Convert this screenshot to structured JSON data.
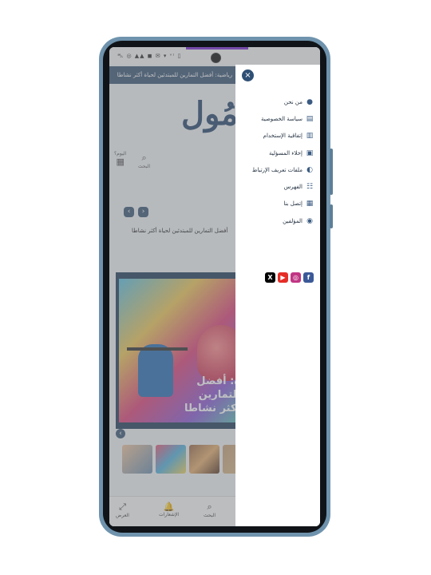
{
  "status_bar": {
    "icons": "⛍ ◎ ▲▲ ◼ ✉ ▾ ᵛᶦ ▯"
  },
  "ticker": {
    "text": "رياضية: أفضل التمارين للمبتدئين لحياة أكثر نشاطا"
  },
  "site": {
    "logo": "مُول"
  },
  "top_nav": {
    "search_label": "البحث",
    "today_label": "اليوم؟"
  },
  "headline": {
    "text": "أفضل التمارين للمبتدئين لحياة أكثر نشاطا"
  },
  "hero": {
    "title_line1": "ة: أفضل التمارين",
    "title_line2": "أكثر نشاطا"
  },
  "bottom_nav": [
    {
      "label": "البحث",
      "icon": "search-icon"
    },
    {
      "label": "الإشعارات",
      "icon": "bell-icon"
    },
    {
      "label": "العرض",
      "icon": "expand-icon"
    }
  ],
  "drawer": {
    "close": "×",
    "items": [
      {
        "label": "من نحن",
        "icon": "person-icon",
        "glyph": "👤"
      },
      {
        "label": "سياسة الخصوصية",
        "icon": "book-icon",
        "glyph": "📖"
      },
      {
        "label": "إتفاقية الإستخدام",
        "icon": "book-open-icon",
        "glyph": "📘"
      },
      {
        "label": "إخلاء المسؤلية",
        "icon": "shop-icon",
        "glyph": "🏪"
      },
      {
        "label": "ملفات تعريف الإرتباط",
        "icon": "cookie-icon",
        "glyph": "◐"
      },
      {
        "label": "الفهرس",
        "icon": "sitemap-icon",
        "glyph": "☷"
      },
      {
        "label": "إتصل بنا",
        "icon": "contact-card-icon",
        "glyph": "▣"
      },
      {
        "label": "المؤلفين",
        "icon": "user-circle-icon",
        "glyph": "◉"
      }
    ],
    "socials": [
      {
        "name": "x",
        "glyph": "X",
        "color": "#000000"
      },
      {
        "name": "youtube",
        "glyph": "▶",
        "color": "#e52d27"
      },
      {
        "name": "instagram",
        "glyph": "◎",
        "color": "#c13584"
      },
      {
        "name": "facebook",
        "glyph": "f",
        "color": "#3b5998"
      }
    ]
  },
  "colors": {
    "accent": "#2f4f75",
    "frame": "#6f93ad"
  }
}
